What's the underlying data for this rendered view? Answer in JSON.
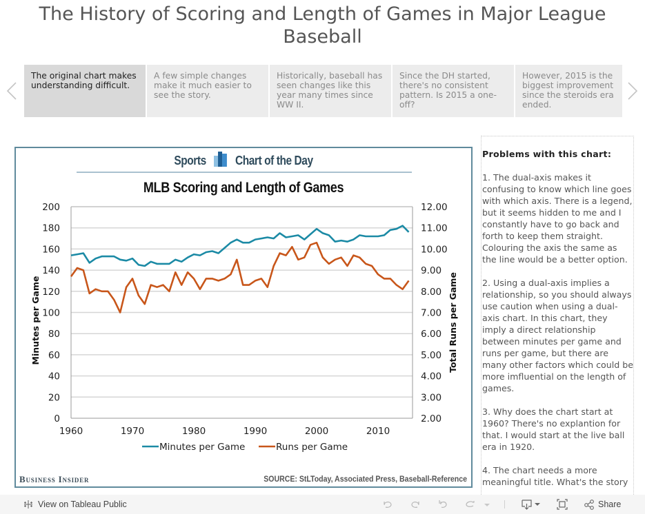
{
  "story": {
    "title": "The History of Scoring and Length of Games in Major League Baseball",
    "prev_icon": "chevron-left-icon",
    "next_icon": "chevron-right-icon",
    "points": [
      {
        "text": "The original chart makes understanding difficult.",
        "active": true
      },
      {
        "text": "A few simple changes make it much easier to see the story.",
        "active": false
      },
      {
        "text": "Historically, baseball has seen changes like this year many times since WW II.",
        "active": false
      },
      {
        "text": "Since the DH started, there's no consistent pattern. Is 2015 a one-off?",
        "active": false
      },
      {
        "text": "However, 2015 is the biggest improvement since the steroids era ended.",
        "active": false
      }
    ]
  },
  "graphic": {
    "brand_left": "Sports",
    "brand_right": "Chart of the Day",
    "brand_icon": "bar-chart-logo-icon",
    "publisher": "Business Insider",
    "source": "SOURCE: StLToday, Associated Press, Baseball-Reference"
  },
  "chart_data": {
    "type": "line",
    "title": "MLB Scoring and Length of Games",
    "xlabel": "",
    "ylabel": "Minutes per Game",
    "y2label": "Total Runs per Game",
    "x_ticks": [
      "1960",
      "1970",
      "1980",
      "1990",
      "2000",
      "2010"
    ],
    "y_ticks": [
      "0",
      "20",
      "40",
      "60",
      "80",
      "100",
      "120",
      "140",
      "160",
      "180",
      "200"
    ],
    "y2_ticks": [
      "2.00",
      "3.00",
      "4.00",
      "5.00",
      "6.00",
      "7.00",
      "8.00",
      "9.00",
      "10.00",
      "11.00",
      "12.00"
    ],
    "xlim": [
      1960,
      2015
    ],
    "ylim": [
      0,
      200
    ],
    "y2lim": [
      2,
      12
    ],
    "grid": true,
    "legend_position": "bottom",
    "x": [
      1960,
      1961,
      1962,
      1963,
      1964,
      1965,
      1966,
      1967,
      1968,
      1969,
      1970,
      1971,
      1972,
      1973,
      1974,
      1975,
      1976,
      1977,
      1978,
      1979,
      1980,
      1981,
      1982,
      1983,
      1984,
      1985,
      1986,
      1987,
      1988,
      1989,
      1990,
      1991,
      1992,
      1993,
      1994,
      1995,
      1996,
      1997,
      1998,
      1999,
      2000,
      2001,
      2002,
      2003,
      2004,
      2005,
      2006,
      2007,
      2008,
      2009,
      2010,
      2011,
      2012,
      2013,
      2014,
      2015
    ],
    "series": [
      {
        "name": "Minutes per Game",
        "axis": "left",
        "color": "#1b8aa5",
        "values": [
          154,
          155,
          156,
          147,
          151,
          153,
          153,
          153,
          150,
          149,
          151,
          145,
          144,
          148,
          146,
          146,
          146,
          150,
          148,
          152,
          155,
          154,
          157,
          158,
          156,
          161,
          166,
          169,
          166,
          166,
          169,
          170,
          171,
          170,
          175,
          171,
          172,
          173,
          169,
          174,
          179,
          175,
          173,
          167,
          168,
          167,
          169,
          173,
          172,
          172,
          172,
          173,
          178,
          179,
          182,
          176
        ]
      },
      {
        "name": "Runs per Game",
        "axis": "right",
        "color": "#c8561a",
        "values": [
          8.7,
          9.1,
          9.0,
          7.9,
          8.1,
          8.0,
          8.0,
          7.6,
          7.0,
          8.2,
          8.6,
          7.8,
          7.4,
          8.3,
          8.2,
          8.3,
          8.0,
          8.9,
          8.3,
          8.9,
          8.6,
          8.1,
          8.6,
          8.6,
          8.5,
          8.6,
          8.8,
          9.5,
          8.3,
          8.3,
          8.5,
          8.6,
          8.2,
          9.2,
          9.8,
          9.7,
          10.1,
          9.5,
          9.6,
          10.2,
          10.3,
          9.6,
          9.3,
          9.5,
          9.6,
          9.2,
          9.7,
          9.6,
          9.3,
          9.2,
          8.8,
          8.6,
          8.6,
          8.3,
          8.1,
          8.5
        ]
      }
    ]
  },
  "notes": {
    "heading": "Problems with this chart:",
    "paragraphs": [
      "1. The dual-axis makes it confusing to know which line goes with which axis. There is a legend, but it seems hidden to me and I constantly have to go back and forth to keep them straight. Colouring the axis the same as the line would be a better option.",
      "2. Using a dual-axis implies a relationship, so you should always use caution when using a dual-axis chart. In this chart, they imply a direct relationship between minutes per game and runs per game, but there are many other factors which could be more imfluential on the length of games.",
      "3. Why does the chart start at 1960? There's no explantion for that. I would start at the live ball era in 1920.",
      "4. The chart needs a more meaningful title. What's the story"
    ]
  },
  "toolbar": {
    "view_on_label": "View on Tableau Public",
    "share_label": "Share",
    "icons": [
      "tableau-logo-icon",
      "undo-icon",
      "redo-icon",
      "revert-icon",
      "refresh-icon",
      "dropdown-icon",
      "download-icon",
      "fullscreen-icon",
      "share-icon"
    ]
  }
}
